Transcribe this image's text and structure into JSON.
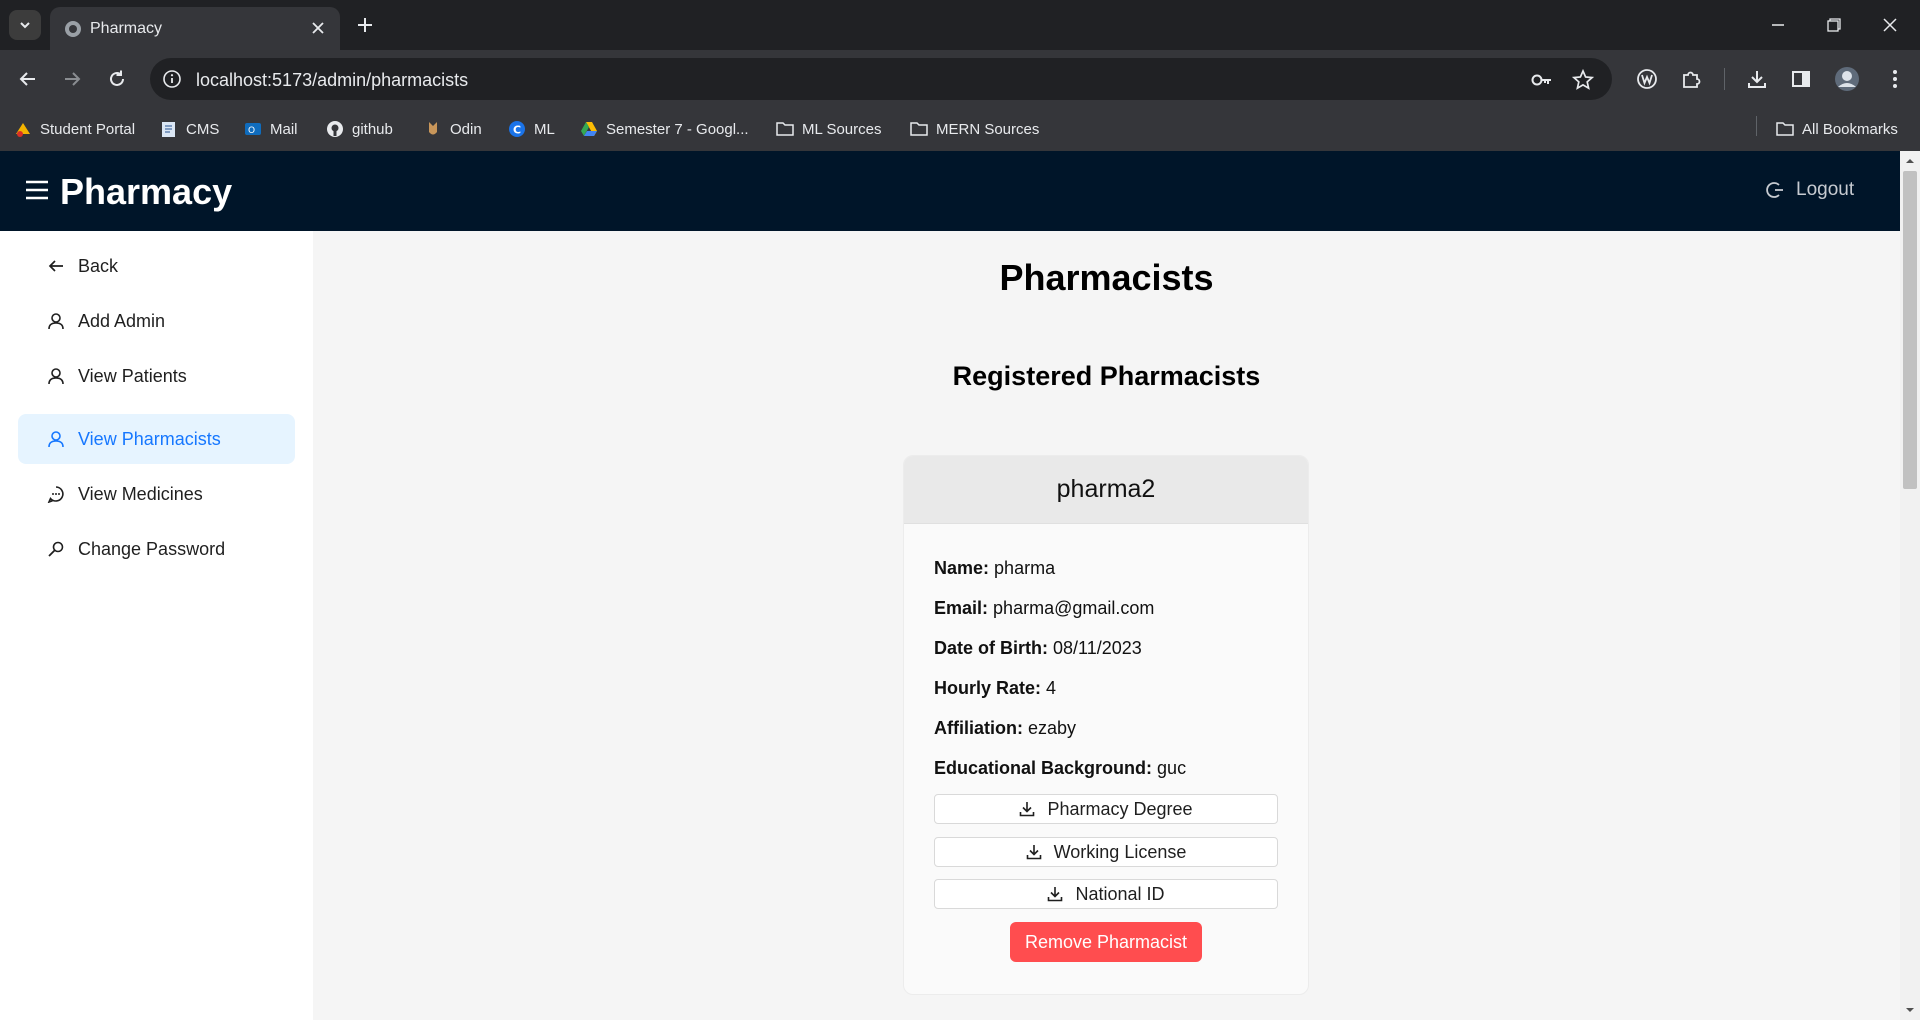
{
  "browser": {
    "tab_title": "Pharmacy",
    "url": "localhost:5173/admin/pharmacists",
    "bookmarks": [
      {
        "label": "Student Portal",
        "icon": "student-portal-icon"
      },
      {
        "label": "CMS",
        "icon": "cms-icon"
      },
      {
        "label": "Mail",
        "icon": "outlook-icon"
      },
      {
        "label": "github",
        "icon": "github-icon"
      },
      {
        "label": "Odin",
        "icon": "odin-icon"
      },
      {
        "label": "ML",
        "icon": "ml-icon"
      },
      {
        "label": "Semester 7 - Googl...",
        "icon": "google-drive-icon"
      },
      {
        "label": "ML Sources",
        "icon": "folder-icon"
      },
      {
        "label": "MERN Sources",
        "icon": "folder-icon"
      }
    ],
    "all_bookmarks": "All Bookmarks"
  },
  "app": {
    "brand": "Pharmacy",
    "logout": "Logout",
    "colors": {
      "header_bg": "#001529",
      "active_bg": "#e6f4ff",
      "active_text": "#1677ff",
      "danger": "#ff4d4f"
    }
  },
  "sidebar": {
    "items": [
      {
        "label": "Back",
        "icon": "arrow-left-icon"
      },
      {
        "label": "Add Admin",
        "icon": "user-icon"
      },
      {
        "label": "View Patients",
        "icon": "user-icon"
      },
      {
        "label": "View Pharmacists",
        "icon": "user-icon",
        "active": true
      },
      {
        "label": "View Medicines",
        "icon": "message-icon"
      },
      {
        "label": "Change Password",
        "icon": "key-icon"
      }
    ]
  },
  "main": {
    "title": "Pharmacists",
    "section_title": "Registered Pharmacists",
    "pharmacist": {
      "username": "pharma2",
      "fields": [
        {
          "label": "Name:",
          "value": "pharma"
        },
        {
          "label": "Email:",
          "value": "pharma@gmail.com"
        },
        {
          "label": "Date of Birth:",
          "value": "08/11/2023"
        },
        {
          "label": "Hourly Rate:",
          "value": "4"
        },
        {
          "label": "Affiliation:",
          "value": "ezaby"
        },
        {
          "label": "Educational Background:",
          "value": "guc"
        }
      ],
      "documents": [
        "Pharmacy Degree",
        "Working License",
        "National ID"
      ],
      "remove_label": "Remove Pharmacist"
    }
  }
}
